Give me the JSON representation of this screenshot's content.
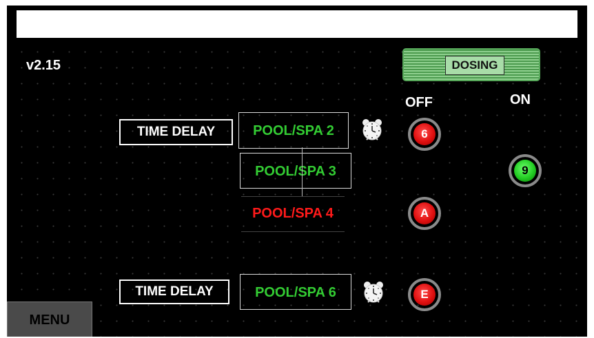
{
  "header": {
    "status_text": ""
  },
  "version": "v2.15",
  "dosing": {
    "label": "DOSING"
  },
  "columns": {
    "off": "OFF",
    "on": "ON"
  },
  "rows": {
    "time_delay_1": "TIME DELAY",
    "pool_spa_2": "POOL/SPA 2",
    "pool_spa_3": "POOL/SPA 3",
    "pool_spa_4": "POOL/SPA 4",
    "time_delay_2": "TIME DELAY",
    "pool_spa_6": "POOL/SPA 6"
  },
  "indicators": {
    "led_6": "6",
    "led_9": "9",
    "led_a": "A",
    "led_e": "E"
  },
  "menu": {
    "label": "MENU"
  },
  "colors": {
    "active_green": "#33cc33",
    "alert_red": "#ff1a1a",
    "led_red": "#e01010",
    "led_green": "#22cc22",
    "dosing_green": "#4c9a4e"
  },
  "icons": {
    "alarm": "alarm-clock-icon"
  }
}
